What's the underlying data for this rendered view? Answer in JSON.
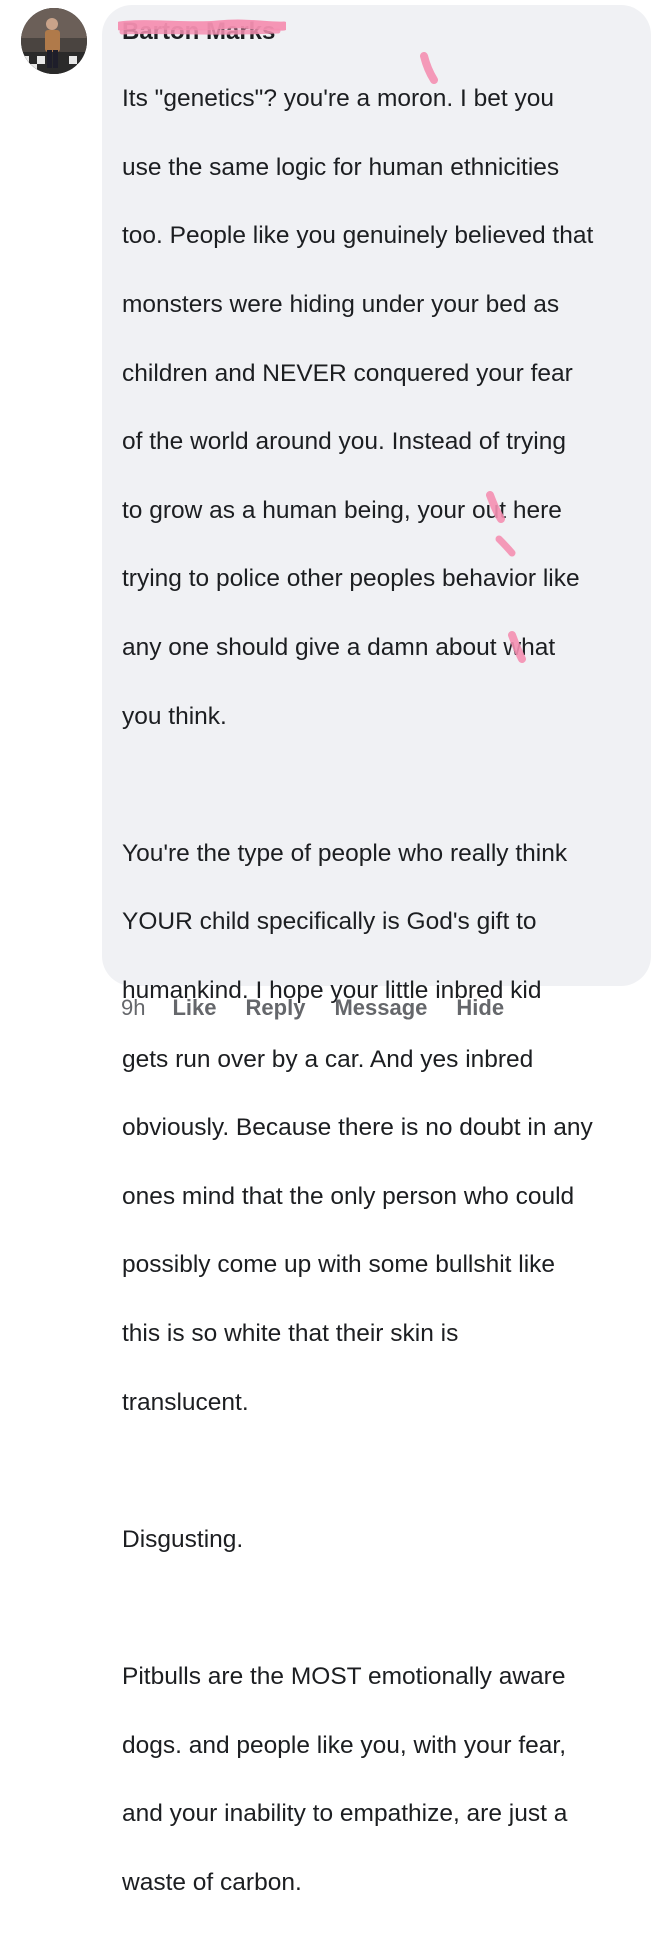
{
  "comment": {
    "author": "Barton Marks",
    "paragraphs": [
      [
        "Its \"genetics\"? you're a moron. I bet you",
        "use the same logic for human ethnicities",
        "too. People like you genuinely believed that",
        "monsters were hiding under your bed as",
        "children and NEVER conquered your fear",
        "of the world around you. Instead of trying",
        "to grow as a human being, your out here",
        "trying to police other peoples behavior like",
        "any one should give a damn about what",
        "you think."
      ],
      [
        "You're the type of people who really think",
        "YOUR child specifically is God's gift to",
        "humankind.  I hope your little inbred kid",
        "gets run over by a car. And yes inbred",
        "obviously. Because there is no doubt in any",
        "ones mind that the only person who could",
        "possibly come up with some bullshit like",
        "this is so white that their skin is",
        "translucent."
      ],
      [
        "Disgusting."
      ],
      [
        "Pitbulls are the MOST emotionally aware",
        "dogs.  and people like you, with your fear,",
        "and your inability to empathize, are just a",
        "waste of carbon."
      ]
    ]
  },
  "actions": {
    "time": "9h",
    "like": "Like",
    "reply": "Reply",
    "message": "Message",
    "hide": "Hide"
  },
  "colors": {
    "bubble": "#f0f1f4",
    "text": "#1c1e21",
    "muted": "#65676b",
    "redaction": "#f48fb1"
  }
}
